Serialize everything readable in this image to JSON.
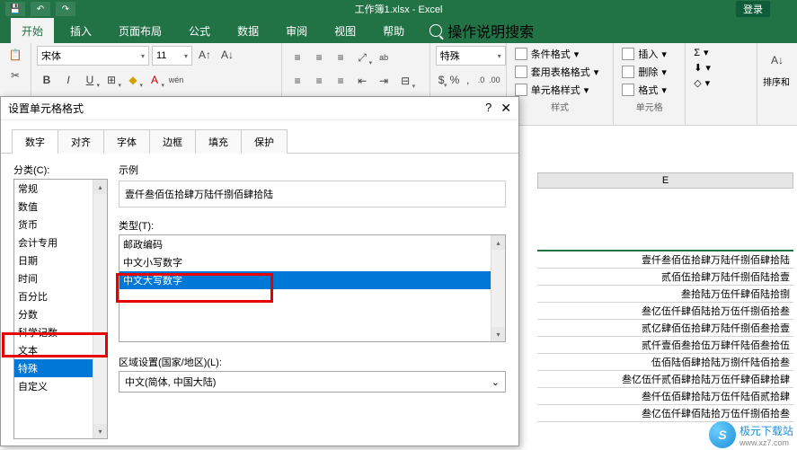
{
  "titlebar": {
    "title": "工作簿1.xlsx - Excel",
    "login": "登录"
  },
  "tabs": {
    "start": "开始",
    "insert": "插入",
    "layout": "页面布局",
    "formula": "公式",
    "data": "数据",
    "review": "审阅",
    "view": "视图",
    "help": "帮助",
    "tellme": "操作说明搜索"
  },
  "ribbon": {
    "font_name": "宋体",
    "font_size": "11",
    "number_format": "特殊",
    "styles": {
      "cond": "条件格式",
      "table": "套用表格格式",
      "cell": "单元格样式",
      "label": "样式"
    },
    "cells": {
      "insert": "插入",
      "delete": "删除",
      "format": "格式",
      "label": "单元格"
    },
    "edit": {
      "sort": "排序和"
    }
  },
  "dialog": {
    "title": "设置单元格格式",
    "tabs": {
      "number": "数字",
      "align": "对齐",
      "font": "字体",
      "border": "边框",
      "fill": "填充",
      "protect": "保护"
    },
    "category_label": "分类(C):",
    "categories": [
      "常规",
      "数值",
      "货币",
      "会计专用",
      "日期",
      "时间",
      "百分比",
      "分数",
      "科学记数",
      "文本",
      "特殊",
      "自定义"
    ],
    "example_label": "示例",
    "example_value": "壹仟叁佰伍拾肆万陆仟捌佰肆拾陆",
    "type_label": "类型(T):",
    "types": [
      "邮政编码",
      "中文小写数字",
      "中文大写数字"
    ],
    "selected_type_index": 2,
    "region_label": "区域设置(国家/地区)(L):",
    "region_value": "中文(简体, 中国大陆)"
  },
  "sheet": {
    "col_letter": "E",
    "rows": [
      "壹仟叁佰伍拾肆万陆仟捌佰肆拾陆",
      "贰佰伍拾肆万陆仟捌佰陆拾壹",
      "叁拾陆万伍仟肆佰陆拾捌",
      "叁亿伍仟肆佰陆拾万伍仟捌佰拾叁",
      "贰亿肆佰伍拾肆万陆仟捌佰叁拾壹",
      "贰仟壹佰叁拾伍万肆仟陆佰叁拾伍",
      "伍佰陆佰肆拾陆万捌仟陆佰拾叁",
      "叁亿伍仟贰佰肆拾陆万伍仟肆佰肆拾肆",
      "叁仟伍佰肆拾陆万伍仟陆佰贰拾肆",
      "叁亿伍仟肆佰陆拾万伍仟捌佰拾叁"
    ]
  },
  "watermark": {
    "logo": "S",
    "text": "极元下载站",
    "sub": "www.xz7.com"
  }
}
